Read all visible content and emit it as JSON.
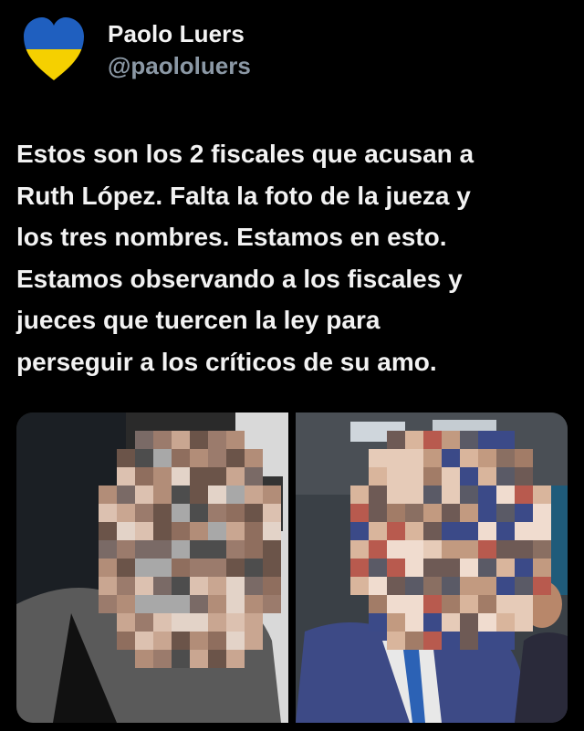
{
  "author": {
    "name": "Paolo Luers",
    "handle": "@paololuers",
    "avatar_icon": "heart-blue-yellow-icon",
    "avatar_colors": {
      "top": "#1f5fbf",
      "bottom": "#f5d000"
    }
  },
  "tweet": {
    "text": "Estos son los 2 fiscales que acusan a\nRuth López. Falta la foto de la jueza y\nlos tres nombres. Estamos en esto.\nEstamos observando a los fiscales y\njueces que tuercen la ley para\nperseguir a los críticos de su amo."
  },
  "media": {
    "count": 2,
    "items": [
      {
        "description": "pixelated-face-woman"
      },
      {
        "description": "pixelated-face-man"
      }
    ]
  }
}
